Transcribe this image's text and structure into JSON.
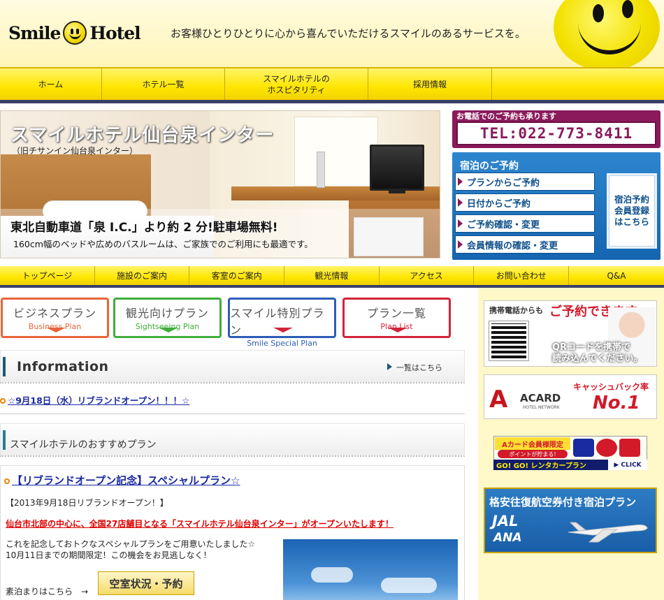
{
  "header": {
    "logo_left": "Smile",
    "logo_right": "Hotel",
    "tagline": "お客様ひとりひとりに心から喜んでいただけるスマイルのあるサービスを。"
  },
  "global_nav": [
    {
      "label": "ホーム"
    },
    {
      "label": "ホテル一覧"
    },
    {
      "label": "スマイルホテルの\nホスピタリティ"
    },
    {
      "label": "採用情報"
    },
    {
      "label": ""
    }
  ],
  "hero": {
    "title": "スマイルホテル仙台泉インター",
    "subtitle": "（旧チサンイン仙台泉インター）",
    "copy": "東北自動車道「泉 I.C.」より約 2 分!駐車場無料!",
    "copy2": "160cm幅のベッドや広めのバスルームは、ご家族でのご利用にも最適です。"
  },
  "phone": {
    "label": "お電話でのご予約も承ります",
    "number": "TEL:022-773-8411"
  },
  "reservation": {
    "title": "宿泊のご予約",
    "buttons": [
      {
        "label": "プランからご予約"
      },
      {
        "label": "日付からご予約"
      },
      {
        "label": "ご予約確認・変更"
      },
      {
        "label": "会員情報の確認・変更"
      }
    ],
    "member_button": "宿泊予約\n会員登録\nはこちら"
  },
  "sub_nav": [
    {
      "label": "トップページ"
    },
    {
      "label": "施設のご案内"
    },
    {
      "label": "客室のご案内"
    },
    {
      "label": "観光情報"
    },
    {
      "label": "アクセス"
    },
    {
      "label": "お問い合わせ"
    },
    {
      "label": "Q&A"
    }
  ],
  "plans": [
    {
      "jp": "ビジネスプラン",
      "en": "Business Plan",
      "color": "#e8643a"
    },
    {
      "jp": "観光向けプラン",
      "en": "Sightseeing Plan",
      "color": "#3fae3a"
    },
    {
      "jp": "スマイル特別プラン",
      "en": "Smile Special Plan",
      "color": "#2c5cb8"
    },
    {
      "jp": "プラン一覧",
      "en": "Plan List",
      "color": "#d2233a"
    }
  ],
  "information": {
    "title": "Information",
    "more": "一覧はこちら",
    "news": [
      "☆9月18日（水）リブランドオープン！！！☆"
    ]
  },
  "recommend": {
    "title": "スマイルホテルのおすすめプラン",
    "plan_title": "【リブランドオープン記念】スペシャルプラン☆",
    "date_line": "【2013年9月18日リブランドオープン！】",
    "red_line": "仙台市北部の中心に、全国27店舗目となる「スマイルホテル仙台泉インター」がオープンいたします！",
    "body_line1": "これを記念しておトクなスペシャルプランをご用意いたしました☆",
    "body_line2": "10月11日までの期間限定！この機会をお見逃しなく！",
    "stay_label": "素泊まりはこちら　→",
    "availability_button": "空室状況・予約"
  },
  "sidebar": {
    "mobile_label": "携帯電話からも",
    "mobile_big": "ご予約できます。",
    "qr_text_line1": "QRコードを携帯で",
    "qr_text_line2": "読み込んでください。",
    "acard_name": "ACARD",
    "acard_net": "HOTEL NETWORK",
    "cashback": "キャッシュバック率",
    "no1": "No.1",
    "rental_top": "Aカード会員様限定",
    "rental_badge": "ポイントが貯まる!",
    "rental_bottom": "GO! GO! レンタカープラン",
    "rental_click": "▶ CLICK",
    "air_title": "格安往復航空券付き宿泊プラン",
    "jal": "JAL",
    "ana": "ANA"
  }
}
